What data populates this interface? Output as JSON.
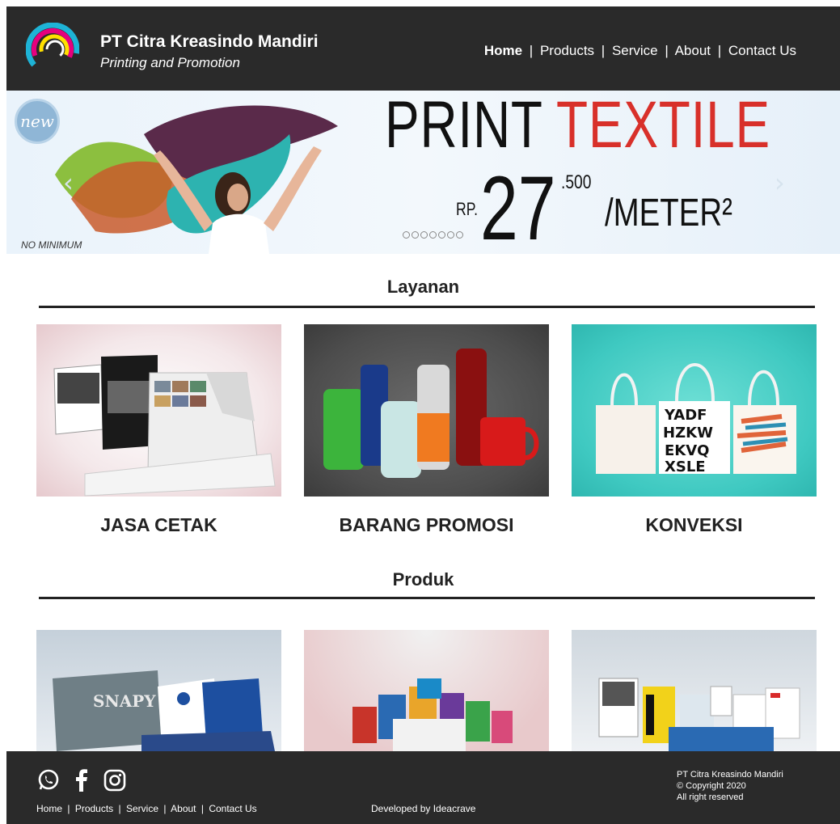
{
  "header": {
    "brand_title": "PT Citra Kreasindo Mandiri",
    "brand_subtitle": "Printing and Promotion",
    "nav": {
      "home": "Home",
      "products": "Products",
      "service": "Service",
      "about": "About",
      "contact": "Contact Us",
      "separator": "|"
    }
  },
  "banner": {
    "badge": "new",
    "headline_print": "PRINT",
    "headline_textile": "TEXTILE",
    "currency": "RP.",
    "price_main": "27",
    "price_cents": ".500",
    "unit": "/METER²",
    "note": "NO MINIMUM",
    "slide_count": 7,
    "accent_color": "#d8302a"
  },
  "layanan": {
    "title": "Layanan",
    "items": [
      {
        "label": "JASA CETAK"
      },
      {
        "label": "BARANG PROMOSI"
      },
      {
        "label": "KONVEKSI"
      }
    ]
  },
  "produk": {
    "title": "Produk"
  },
  "footer": {
    "links": {
      "home": "Home",
      "products": "Products",
      "service": "Service",
      "about": "About",
      "contact": "Contact Us",
      "separator": "|"
    },
    "developed_by": "Developed by Ideacrave",
    "company": "PT Citra Kreasindo Mandiri",
    "copyright": "© Copyright 2020",
    "rights": "All right reserved",
    "social_icons": [
      "whatsapp-icon",
      "facebook-icon",
      "instagram-icon"
    ]
  },
  "colors": {
    "header_bg": "#2a2a2a",
    "footer_bg": "#2a2a2a",
    "text_dark": "#222222"
  }
}
